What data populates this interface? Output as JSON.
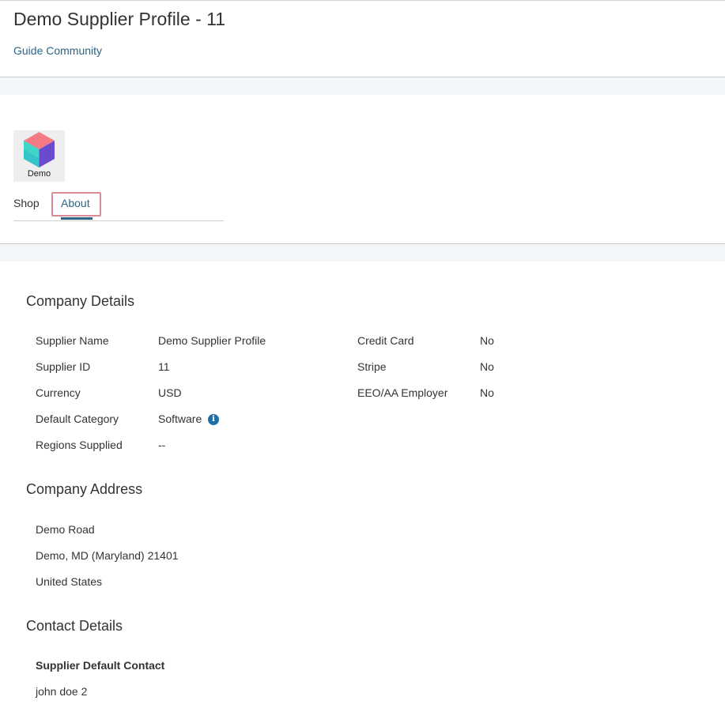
{
  "header": {
    "title": "Demo Supplier Profile - 11",
    "community_link": "Guide Community"
  },
  "profile": {
    "logo_caption": "Demo",
    "logo_colors": {
      "top": "#f47b84",
      "left": "#3dd6c8",
      "right": "#6a4bd0"
    },
    "tabs": [
      {
        "label": "Shop",
        "active": false
      },
      {
        "label": "About",
        "active": true
      }
    ]
  },
  "company_details": {
    "title": "Company Details",
    "left_rows": [
      {
        "label": "Supplier Name",
        "value": "Demo Supplier Profile"
      },
      {
        "label": "Supplier ID",
        "value": "11"
      },
      {
        "label": "Currency",
        "value": "USD"
      },
      {
        "label": "Default Category",
        "value": "Software",
        "icon": "info-icon"
      },
      {
        "label": "Regions Supplied",
        "value": "--"
      }
    ],
    "right_rows": [
      {
        "label": "Credit Card",
        "value": "No"
      },
      {
        "label": "Stripe",
        "value": "No"
      },
      {
        "label": "EEO/AA Employer",
        "value": "No"
      }
    ]
  },
  "company_address": {
    "title": "Company Address",
    "lines": [
      "Demo Road",
      "Demo, MD (Maryland) 21401",
      "United States"
    ]
  },
  "contact_details": {
    "title": "Contact Details",
    "subtitle": "Supplier Default Contact",
    "name": "john doe 2"
  },
  "colors": {
    "link": "#2e6486",
    "info_icon": "#1d6fa5",
    "highlight": "#d98a96"
  }
}
